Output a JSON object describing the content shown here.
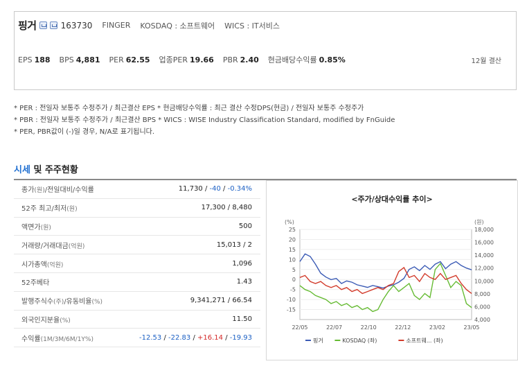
{
  "header": {
    "name": "핑거",
    "code": "163730",
    "english_name": "FINGER",
    "market": "KOSDAQ : 소프트웨어",
    "wics": "WICS : IT서비스",
    "fiscal": "12월 결산"
  },
  "metrics": [
    {
      "label": "EPS",
      "value": "188"
    },
    {
      "label": "BPS",
      "value": "4,881"
    },
    {
      "label": "PER",
      "value": "62.55"
    },
    {
      "label": "업종PER",
      "value": "19.66"
    },
    {
      "label": "PBR",
      "value": "2.40"
    },
    {
      "label": "현금배당수익률",
      "value": "0.85%"
    }
  ],
  "notes": [
    "* PER : 전일자 보통주 수정주가 / 최근결산 EPS * 현금배당수익률 : 최근 결산 수정DPS(현금) / 전일자 보통주 수정주가",
    "* PBR : 전일자 보통주 수정주가 / 최근결산 BPS * WICS : WISE Industry Classification Standard, modified by FnGuide",
    "* PER, PBR값이 (-)일 경우, N/A로 표기됩니다."
  ],
  "section": {
    "accent": "시세",
    "rest": " 및 주주현황"
  },
  "table": {
    "rows": [
      {
        "label": "종가",
        "unit": "(원)",
        "label2": "/전일대비/수익률",
        "value": ""
      },
      {
        "label": "52주 최고/최저",
        "unit": "(원)",
        "value": "17,300 / 8,480"
      },
      {
        "label": "액면가",
        "unit": "(원)",
        "value": "500"
      },
      {
        "label": "거래량/거래대금",
        "unit": "(억원)",
        "value": "15,013 / 2"
      },
      {
        "label": "시가총액",
        "unit": "(억원)",
        "value": "1,096"
      },
      {
        "label": "52주베타",
        "unit": "",
        "value": "1.43"
      },
      {
        "label": "발행주식수",
        "unit": "(주)",
        "label2": "/유동비율",
        "unit2": "(%)",
        "value": "9,341,271 / 66.54"
      },
      {
        "label": "외국인지분율",
        "unit": "(%)",
        "value": "11.50"
      },
      {
        "label": "수익률",
        "unit": "(1M/3M/6M/1Y%)",
        "value": ""
      }
    ],
    "price": {
      "close": "11,730",
      "change": "-40",
      "rate": "-0.34%"
    },
    "returns": {
      "m1": "-12.53",
      "m3": "-22.83",
      "m6": "+16.14",
      "y1": "-19.93"
    }
  },
  "chart_data": {
    "type": "line",
    "title": "<주가/상대수익률 추이>",
    "left_unit": "(%)",
    "right_unit": "(원)",
    "ylim_left": [
      -20,
      25
    ],
    "ylim_right": [
      4000,
      18000
    ],
    "yticks_left": [
      "25",
      "20",
      "15",
      "10",
      "5",
      "0",
      "-5",
      "-10",
      "-15"
    ],
    "yticks_right": [
      "18,000",
      "16,000",
      "14,000",
      "12,000",
      "10,000",
      "8,000",
      "6,000",
      "4,000"
    ],
    "x_labels": [
      "22/05",
      "22/07",
      "22/10",
      "22/12",
      "23/02",
      "23/05"
    ],
    "series": [
      {
        "name": "핑거",
        "color": "#3b5bb5",
        "axis": "right",
        "values": [
          13000,
          14200,
          13800,
          12600,
          11200,
          10600,
          10200,
          10400,
          9600,
          10000,
          9800,
          9400,
          9200,
          9000,
          9300,
          9100,
          8900,
          9200,
          9400,
          9800,
          10400,
          11800,
          12200,
          11600,
          12400,
          11800,
          12600,
          13000,
          11900,
          12600,
          13000,
          12400,
          12000,
          11730
        ]
      },
      {
        "name": "KOSDAQ (좌)",
        "color": "#66bb33",
        "axis": "left",
        "values": [
          -3,
          -5,
          -6,
          -8,
          -9,
          -10,
          -12,
          -11,
          -13,
          -12,
          -14,
          -13,
          -15,
          -14,
          -16,
          -15,
          -10,
          -6,
          -3,
          -6,
          -4,
          -2,
          -8,
          -10,
          -7,
          -9,
          5,
          8,
          2,
          -4,
          -1,
          -3,
          -12,
          -14
        ]
      },
      {
        "name": "소프트웨... (좌)",
        "color": "#d23a2a",
        "axis": "left",
        "values": [
          1,
          2,
          -1,
          -2,
          -1,
          -3,
          -4,
          -3,
          -5,
          -4,
          -6,
          -5,
          -7,
          -6,
          -5,
          -4,
          -5,
          -3,
          -2,
          4,
          6,
          1,
          2,
          -1,
          3,
          1,
          0,
          3,
          0,
          1,
          2,
          -2,
          -5,
          -7
        ]
      }
    ],
    "legend_position": "bottom"
  }
}
